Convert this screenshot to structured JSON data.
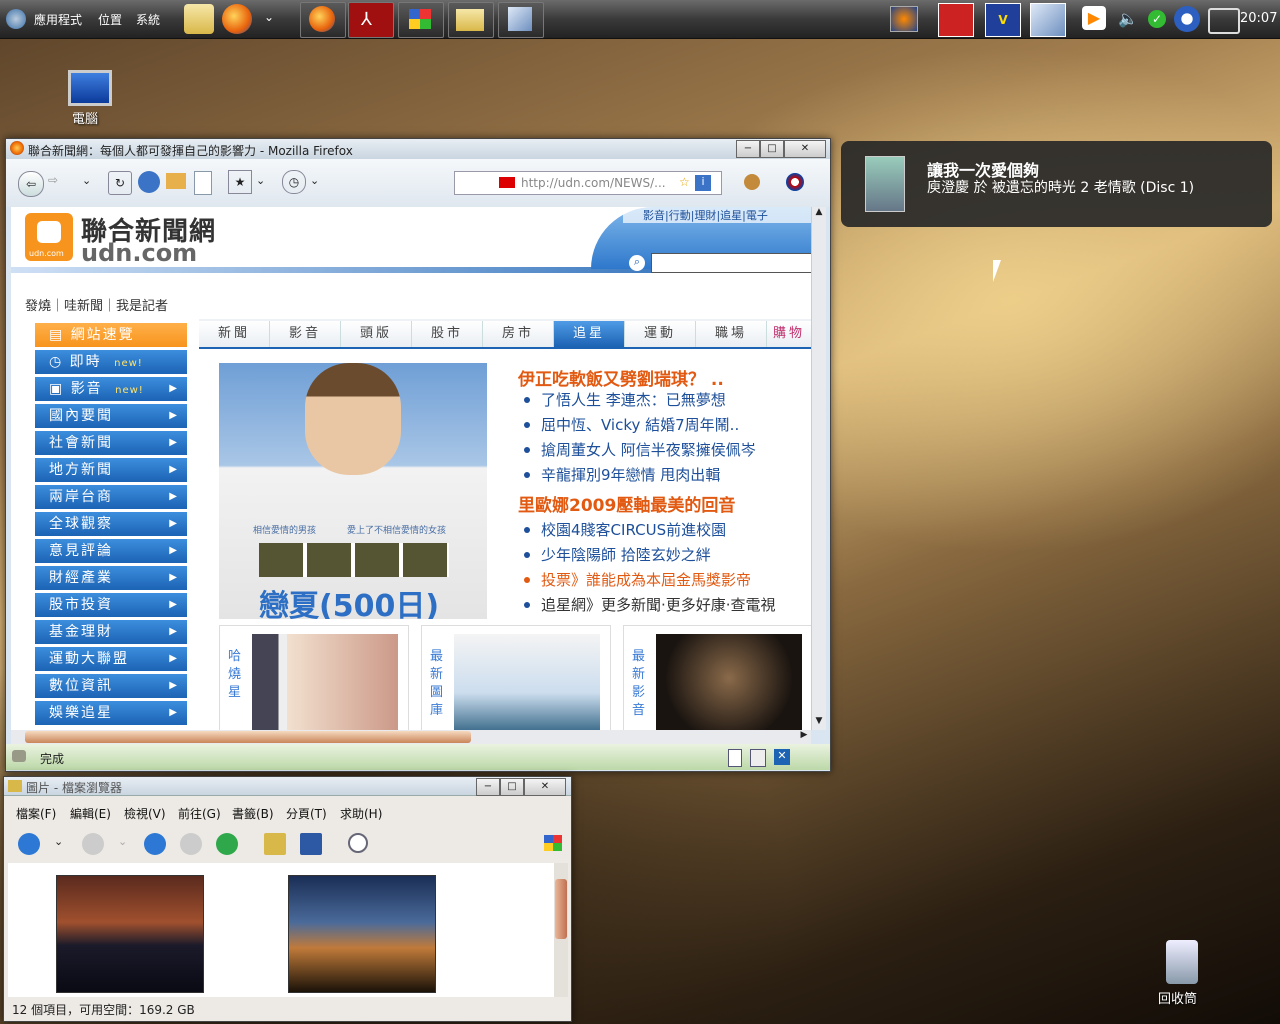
{
  "top_panel": {
    "menus": [
      "應用程式",
      "位置",
      "系統"
    ],
    "clock": "20:07",
    "task_icons": [
      "firefox-icon",
      "pdf-reader-icon",
      "windows-flag-icon",
      "folder-icon",
      "cube-icon"
    ],
    "tray_icons": [
      "firefox-icon",
      "book-icon",
      "checkmark-app-icon",
      "cube-icon",
      "media-player-icon",
      "volume-icon",
      "update-check-icon",
      "network-icon",
      "network-wired-icon"
    ]
  },
  "desktop": {
    "computer_label": "電腦",
    "trash_label": "回收筒"
  },
  "notification": {
    "title": "讓我一次愛個夠",
    "body": "庾澄慶 於 被遺忘的時光 2 老情歌 (Disc 1)"
  },
  "firefox": {
    "title": "聯合新聞網：每個人都可發揮自己的影響力 - Mozilla Firefox",
    "url": "http://udn.com/NEWS/...",
    "status": "完成",
    "site": {
      "logo_cn": "聯合新聞網",
      "logo_en": "udn.com",
      "logo_small": "udn.com",
      "top_links": [
        "影音",
        "行動",
        "理財",
        "追星",
        "電子"
      ],
      "sublinks": "發燒｜哇新聞｜我是記者",
      "sidebar": [
        {
          "label": "網站速覽",
          "active": true,
          "arrow": ""
        },
        {
          "label": "即時",
          "badge": "new!",
          "arrow": ""
        },
        {
          "label": "影音",
          "badge": "new!",
          "arrow": "▶"
        },
        {
          "label": "國內要聞",
          "arrow": "▶"
        },
        {
          "label": "社會新聞",
          "arrow": "▶"
        },
        {
          "label": "地方新聞",
          "arrow": "▶"
        },
        {
          "label": "兩岸台商",
          "arrow": "▶"
        },
        {
          "label": "全球觀察",
          "arrow": "▶"
        },
        {
          "label": "意見評論",
          "arrow": "▶"
        },
        {
          "label": "財經產業",
          "arrow": "▶"
        },
        {
          "label": "股市投資",
          "arrow": "▶"
        },
        {
          "label": "基金理財",
          "arrow": "▶"
        },
        {
          "label": "運動大聯盟",
          "arrow": "▶"
        },
        {
          "label": "數位資訊",
          "arrow": "▶"
        },
        {
          "label": "娛樂追星",
          "arrow": "▶"
        }
      ],
      "tabs": [
        "新聞",
        "影音",
        "頭版",
        "股市",
        "房市",
        "追星",
        "運動",
        "職場",
        "購物"
      ],
      "active_tab": "追星",
      "poster": {
        "tagline_left": "相信愛情的男孩",
        "tagline_right": "愛上了不相信愛情的女孩",
        "title": "戀夏(500日)"
      },
      "headline1": "伊正吃軟飯又劈劉瑞琪？ ..",
      "links1": [
        "了悟人生 李連杰：已無夢想",
        "屈中恆、Vicky 結婚7周年鬧..",
        "搶周董女人 阿信半夜緊擁侯佩岑",
        "辛龍揮別9年戀情 甩肉出輯"
      ],
      "headline2": "里歐娜2009壓軸最美的回音",
      "links2": [
        "校園4賤客CIRCUS前進校園",
        "少年陰陽師 拾陸玄妙之絆",
        "投票》誰能成為本屆金馬獎影帝",
        "追星網》更多新聞‧更多好康‧查電視"
      ],
      "thumbs": [
        "哈燒星",
        "最新圖庫",
        "最新影音"
      ]
    }
  },
  "file_browser": {
    "title": "圖片 - 檔案瀏覽器",
    "menus": [
      "檔案(F)",
      "編輯(E)",
      "檢視(V)",
      "前往(G)",
      "書籤(B)",
      "分頁(T)",
      "求助(H)"
    ],
    "status": "12 個項目，可用空間：169.2 GB"
  },
  "colors": {
    "udn_orange": "#f7941d",
    "udn_blue": "#1c63b4",
    "headline_orange": "#e25a12",
    "link_blue": "#1d4f9a"
  }
}
